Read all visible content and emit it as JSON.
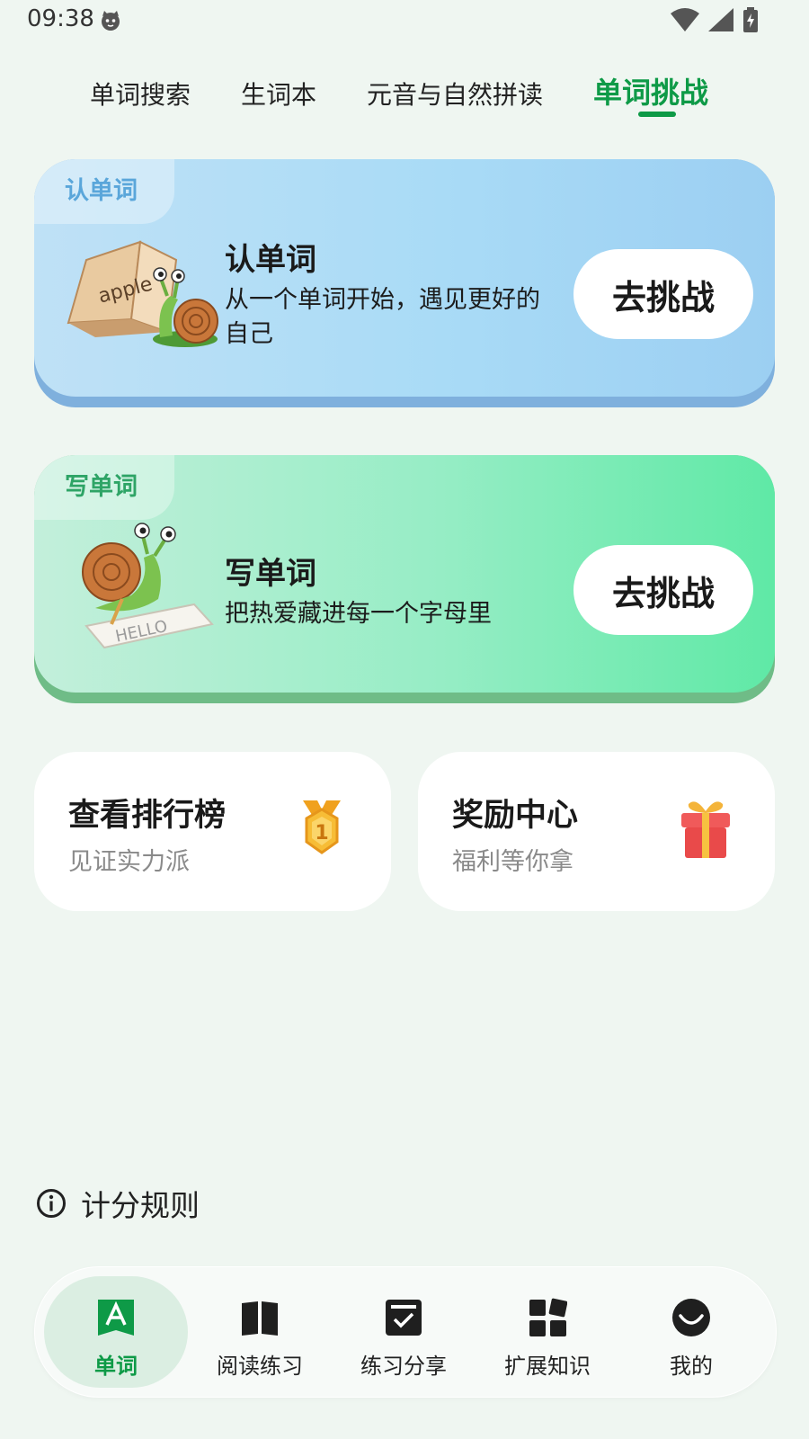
{
  "status_bar": {
    "time": "09:38"
  },
  "tabs": [
    {
      "label": "单词搜索",
      "active": false
    },
    {
      "label": "生词本",
      "active": false
    },
    {
      "label": "元音与自然拼读",
      "active": false
    },
    {
      "label": "单词挑战",
      "active": true
    }
  ],
  "cards": [
    {
      "tag": "认单词",
      "title": "认单词",
      "description": "从一个单词开始，遇见更好的自己",
      "illustration_text": "apple",
      "button": "去挑战",
      "color": "#a9dbf6"
    },
    {
      "tag": "写单词",
      "title": "写单词",
      "description": "把热爱藏进每一个字母里",
      "illustration_text": "HELLO",
      "button": "去挑战",
      "color": "#96edc5"
    }
  ],
  "mini_cards": [
    {
      "title": "查看排行榜",
      "subtitle": "见证实力派",
      "icon": "medal-icon",
      "medal_number": "1"
    },
    {
      "title": "奖励中心",
      "subtitle": "福利等你拿",
      "icon": "gift-icon"
    }
  ],
  "rules": {
    "label": "计分规则",
    "icon": "info-icon"
  },
  "bottom_nav": [
    {
      "label": "单词",
      "icon": "word-icon",
      "active": true
    },
    {
      "label": "阅读练习",
      "icon": "book-icon",
      "active": false
    },
    {
      "label": "练习分享",
      "icon": "check-box-icon",
      "active": false
    },
    {
      "label": "扩展知识",
      "icon": "blocks-icon",
      "active": false
    },
    {
      "label": "我的",
      "icon": "profile-icon",
      "active": false
    }
  ],
  "accent_color": "#0e9a47"
}
